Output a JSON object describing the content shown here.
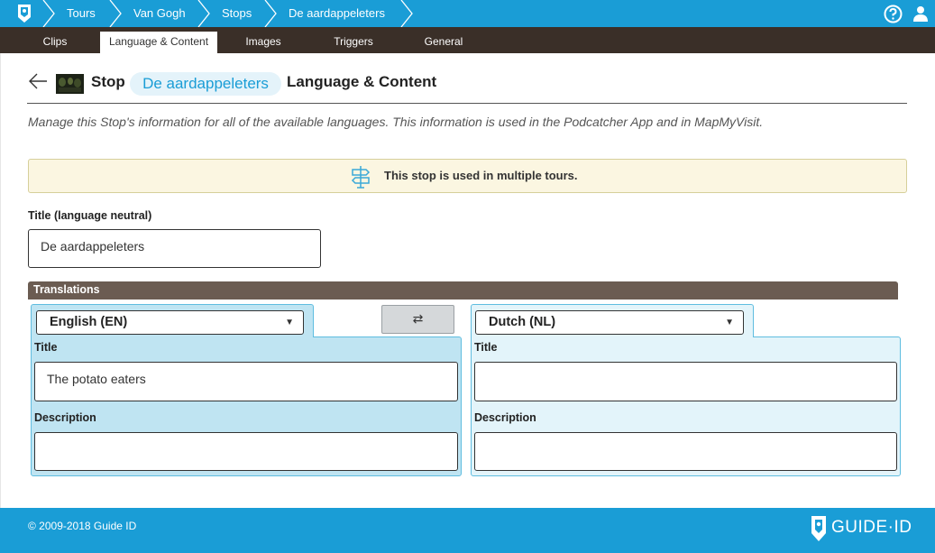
{
  "breadcrumb": {
    "items": [
      {
        "label": "Tours"
      },
      {
        "label": "Van Gogh"
      },
      {
        "label": "Stops"
      },
      {
        "label": "De aardappeleters"
      }
    ],
    "icons": {
      "logo": "guide-id-logo-icon",
      "help": "help-icon",
      "user": "user-icon"
    }
  },
  "tabs": [
    {
      "label": "Clips",
      "active": false
    },
    {
      "label": "Language & Content",
      "active": true
    },
    {
      "label": "Images",
      "active": false
    },
    {
      "label": "Triggers",
      "active": false
    },
    {
      "label": "General",
      "active": false
    }
  ],
  "header": {
    "prefix": "Stop",
    "stop_name": "De aardappeleters",
    "suffix": "Language & Content",
    "intro": "Manage this Stop's information for all of the available languages. This information is used in the Podcatcher App and in MapMyVisit."
  },
  "notice": {
    "text": "This stop is used in multiple tours.",
    "icon": "signpost-icon"
  },
  "neutral_title": {
    "label": "Title (language neutral)",
    "value": "De aardappeleters"
  },
  "translations": {
    "heading": "Translations",
    "swap_icon": "swap-arrows-icon",
    "swap_symbol": "⇄",
    "left": {
      "language": "English (EN)",
      "title_label": "Title",
      "title_value": "The potato eaters",
      "description_label": "Description",
      "description_value": ""
    },
    "right": {
      "language": "Dutch (NL)",
      "title_label": "Title",
      "title_value": "",
      "description_label": "Description",
      "description_value": ""
    }
  },
  "footer": {
    "copyright": "© 2009-2018 Guide ID",
    "brand": "GUIDE·ID"
  },
  "colors": {
    "primary": "#1a9dd6",
    "tabbar": "#3a2f28",
    "translations_bar": "#6b5c52",
    "panel_left": "#bfe4f2",
    "panel_right": "#e3f4fa",
    "notice_bg": "#fbf6e1"
  }
}
